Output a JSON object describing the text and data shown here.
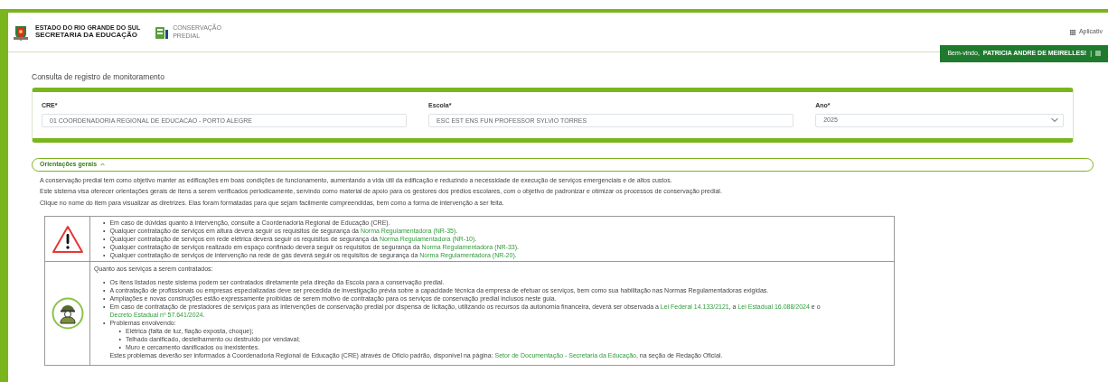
{
  "header": {
    "state_line1": "ESTADO DO RIO GRANDE DO SUL",
    "state_line2": "SECRETARIA DA EDUCAÇÃO",
    "app_line1": "CONSERVAÇÃO",
    "app_line2": "PREDIAL",
    "apps_label": "Aplicativ"
  },
  "user_bar": {
    "greeting": "Bem-vindo,",
    "user": "PATRICIA ANDRE DE MEIRELLES!",
    "separator": "|"
  },
  "page_title": "Consulta de registro de monitoramento",
  "filters": [
    {
      "kind": "input",
      "label": "CRE*",
      "value": "01 COORDENADORIA REGIONAL DE EDUCACAO - PORTO ALEGRE"
    },
    {
      "kind": "input",
      "label": "Escola*",
      "value": "ESC EST ENS FUN PROFESSOR SYLVIO TORRES"
    },
    {
      "kind": "select",
      "label": "Ano*",
      "value": "2025"
    }
  ],
  "guidance": {
    "label": "Orientações gerais",
    "expanded": true,
    "paragraphs": [
      "A conservação predial tem como objetivo manter as edificações em boas condições de funcionamento, aumentando a vida útil da edificação e reduzindo a necessidade de execução de serviços emergenciais e de altos custos.",
      "Este sistema visa oferecer orientações gerais de itens a serem verificados periodicamente, servindo como material de apoio para os gestores dos prédios escolares, com o objetivo de padronizar e otimizar os processos de conservação predial.",
      "Clique no nome do item para visualizar as diretrizes. Elas foram formatadas para que sejam facilmente compreendidas, bem como a forma de intervenção a ser feita."
    ]
  },
  "notice_rows": [
    {
      "kind": "warning",
      "items": [
        {
          "marker": "•",
          "parts": [
            {
              "kind": "text",
              "text": "Em caso de dúvidas quanto à intervenção, consulte a Coordenadoria Regional de Educação (CRE)."
            }
          ]
        },
        {
          "marker": "•",
          "parts": [
            {
              "kind": "text",
              "text": "Qualquer contratação de serviços em altura deverá seguir os requisitos de segurança da "
            },
            {
              "kind": "link",
              "text": "Norma Regulamentadora (NR-35)"
            },
            {
              "kind": "text",
              "text": "."
            }
          ]
        },
        {
          "marker": "•",
          "parts": [
            {
              "kind": "text",
              "text": "Qualquer contratação de serviços em rede elétrica deverá seguir os requisitos de segurança da "
            },
            {
              "kind": "link",
              "text": "Norma Regulamentadora (NR-10)"
            },
            {
              "kind": "text",
              "text": "."
            }
          ]
        },
        {
          "marker": "•",
          "parts": [
            {
              "kind": "text",
              "text": "Qualquer contratação de serviços realizado em espaço confinado deverá seguir os requisitos de segurança da "
            },
            {
              "kind": "link",
              "text": "Norma Regulamentadora (NR-33)"
            },
            {
              "kind": "text",
              "text": "."
            }
          ]
        },
        {
          "marker": "•",
          "parts": [
            {
              "kind": "text",
              "text": "Qualquer contratação de serviços de intervenção na rede de gás deverá seguir os requisitos de segurança da "
            },
            {
              "kind": "link",
              "text": "Norma Regulamentadora (NR-20)"
            },
            {
              "kind": "text",
              "text": "."
            }
          ]
        }
      ]
    },
    {
      "kind": "worker",
      "intro": "Quanto aos serviços a serem contratados:",
      "items": [
        {
          "marker": "•",
          "parts": [
            {
              "kind": "text",
              "text": "Os itens listados neste sistema podem ser contratados diretamente pela direção da Escola para a conservação predial."
            }
          ]
        },
        {
          "marker": "•",
          "parts": [
            {
              "kind": "text",
              "text": "A contratação de profissionais ou empresas especializadas deve ser precedida de investigação prévia sobre a capacidade técnica da empresa de efetuar os serviços, bem como sua habilitação nas Normas Regulamentadoras exigidas."
            }
          ]
        },
        {
          "marker": "•",
          "parts": [
            {
              "kind": "text",
              "text": "Ampliações e novas construções estão expressamente proibidas de serem motivo de contratação para os serviços de conservação predial inclusos neste guia."
            }
          ]
        },
        {
          "marker": "•",
          "parts": [
            {
              "kind": "text",
              "text": "Em caso de contratação de prestadores de serviços para as intervenções de conservação predial por dispensa de licitação, utilizando os recursos da autonomia financeira, deverá ser observada a "
            },
            {
              "kind": "link",
              "text": "Lei Federal 14.133/2121"
            },
            {
              "kind": "text",
              "text": ", a "
            },
            {
              "kind": "link",
              "text": "Lei Estadual 16.088/2024"
            },
            {
              "kind": "text",
              "text": " e o "
            },
            {
              "kind": "link",
              "text": "Decreto Estadual nº 57.641/2024"
            },
            {
              "kind": "text",
              "text": "."
            }
          ]
        },
        {
          "marker": "•",
          "parts": [
            {
              "kind": "text",
              "text": "Problemas envolvendo:"
            }
          ],
          "children": [
            {
              "marker": "•",
              "parts": [
                {
                  "kind": "text",
                  "text": "Elétrica (falta de luz, fiação exposta, choque);"
                }
              ]
            },
            {
              "marker": "•",
              "parts": [
                {
                  "kind": "text",
                  "text": "Telhado danificado, destelhamento ou destruído por vendaval;"
                }
              ]
            },
            {
              "marker": "•",
              "parts": [
                {
                  "kind": "text",
                  "text": "Muro e cercamento danificados ou inexistentes."
                }
              ]
            }
          ],
          "note": [
            {
              "kind": "text",
              "text": "Estes problemas deverão ser informados à Coordenadoria Regional de Educação (CRE) através de Ofício padrão, disponível na página: "
            },
            {
              "kind": "link",
              "text": "Setor de Documentação - Secretaria da Educação"
            },
            {
              "kind": "text",
              "text": ", na seção de Redação Oficial."
            }
          ]
        }
      ]
    }
  ]
}
